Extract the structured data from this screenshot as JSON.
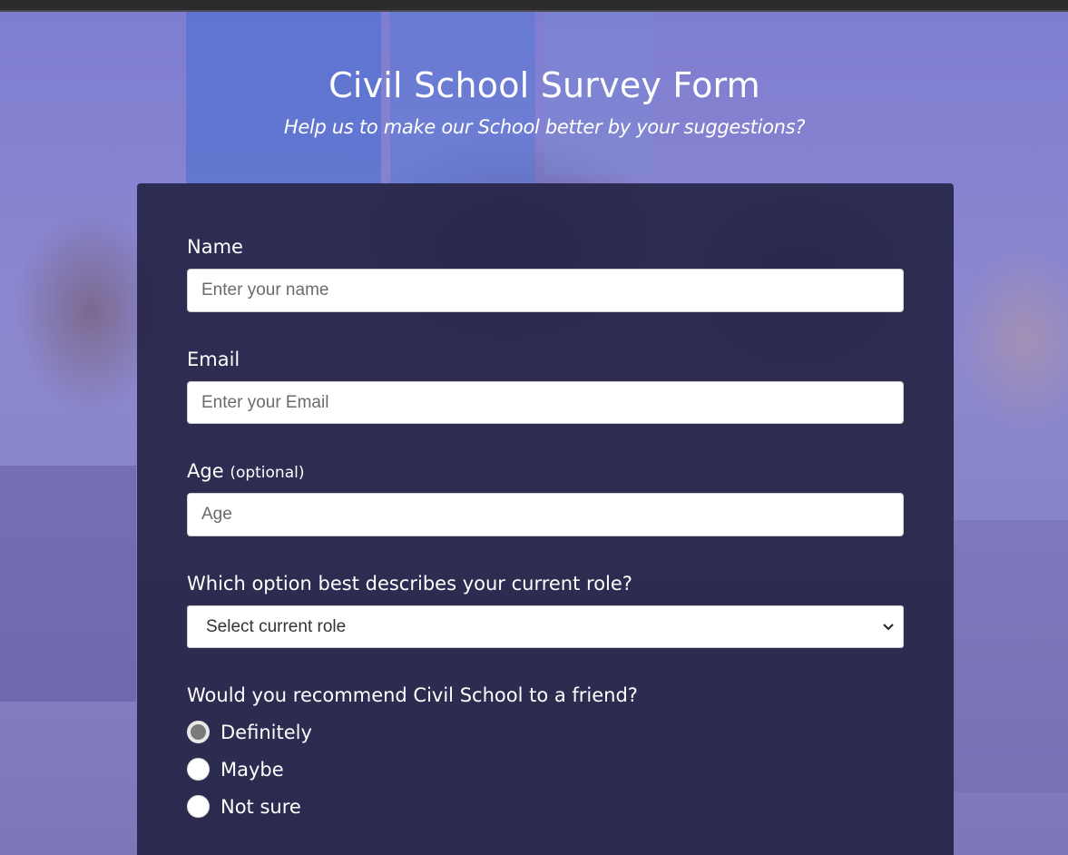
{
  "page": {
    "title": "Civil School Survey Form",
    "subtitle": "Help us to make our School better by your suggestions?"
  },
  "form": {
    "name": {
      "label": "Name",
      "placeholder": "Enter your name"
    },
    "email": {
      "label": "Email",
      "placeholder": "Enter your Email"
    },
    "age": {
      "label": "Age",
      "optional_note": "(optional)",
      "placeholder": "Age"
    },
    "role": {
      "label": "Which option best describes your current role?",
      "selected": "Select current role"
    },
    "recommend": {
      "label": "Would you recommend Civil School to a friend?",
      "options": [
        "Definitely",
        "Maybe",
        "Not sure"
      ],
      "selected_index": 0
    }
  },
  "colors": {
    "card_bg": "#242244",
    "background_tint": "#8a86cc",
    "text": "#ffffff"
  }
}
